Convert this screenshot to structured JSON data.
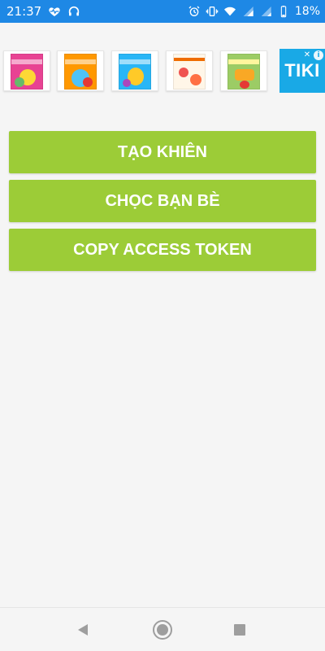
{
  "status_bar": {
    "time": "21:37",
    "battery": "18%",
    "icons": [
      "heart-monitor-icon",
      "headset-icon",
      "alarm-icon",
      "vibrate-icon",
      "wifi-icon",
      "signal-icon",
      "signal-icon",
      "battery-icon"
    ],
    "background_color": "#1e88e5"
  },
  "ad_banner": {
    "logo_text": "TIKI",
    "ad_choices_icon": "info-icon",
    "close_icon": "close-icon",
    "products": [
      {
        "name": "product-thumbnail-1"
      },
      {
        "name": "product-thumbnail-2"
      },
      {
        "name": "product-thumbnail-3"
      },
      {
        "name": "product-thumbnail-4"
      },
      {
        "name": "product-thumbnail-5"
      }
    ]
  },
  "buttons": {
    "create_shield": "TẠO KHIÊN",
    "poke_friends": "CHỌC BẠN BÈ",
    "copy_token": "COPY ACCESS TOKEN",
    "color": "#9ccc37"
  },
  "nav_bar": {
    "back_icon": "back-triangle-icon",
    "home_icon": "home-circle-icon",
    "recents_icon": "recents-square-icon"
  }
}
